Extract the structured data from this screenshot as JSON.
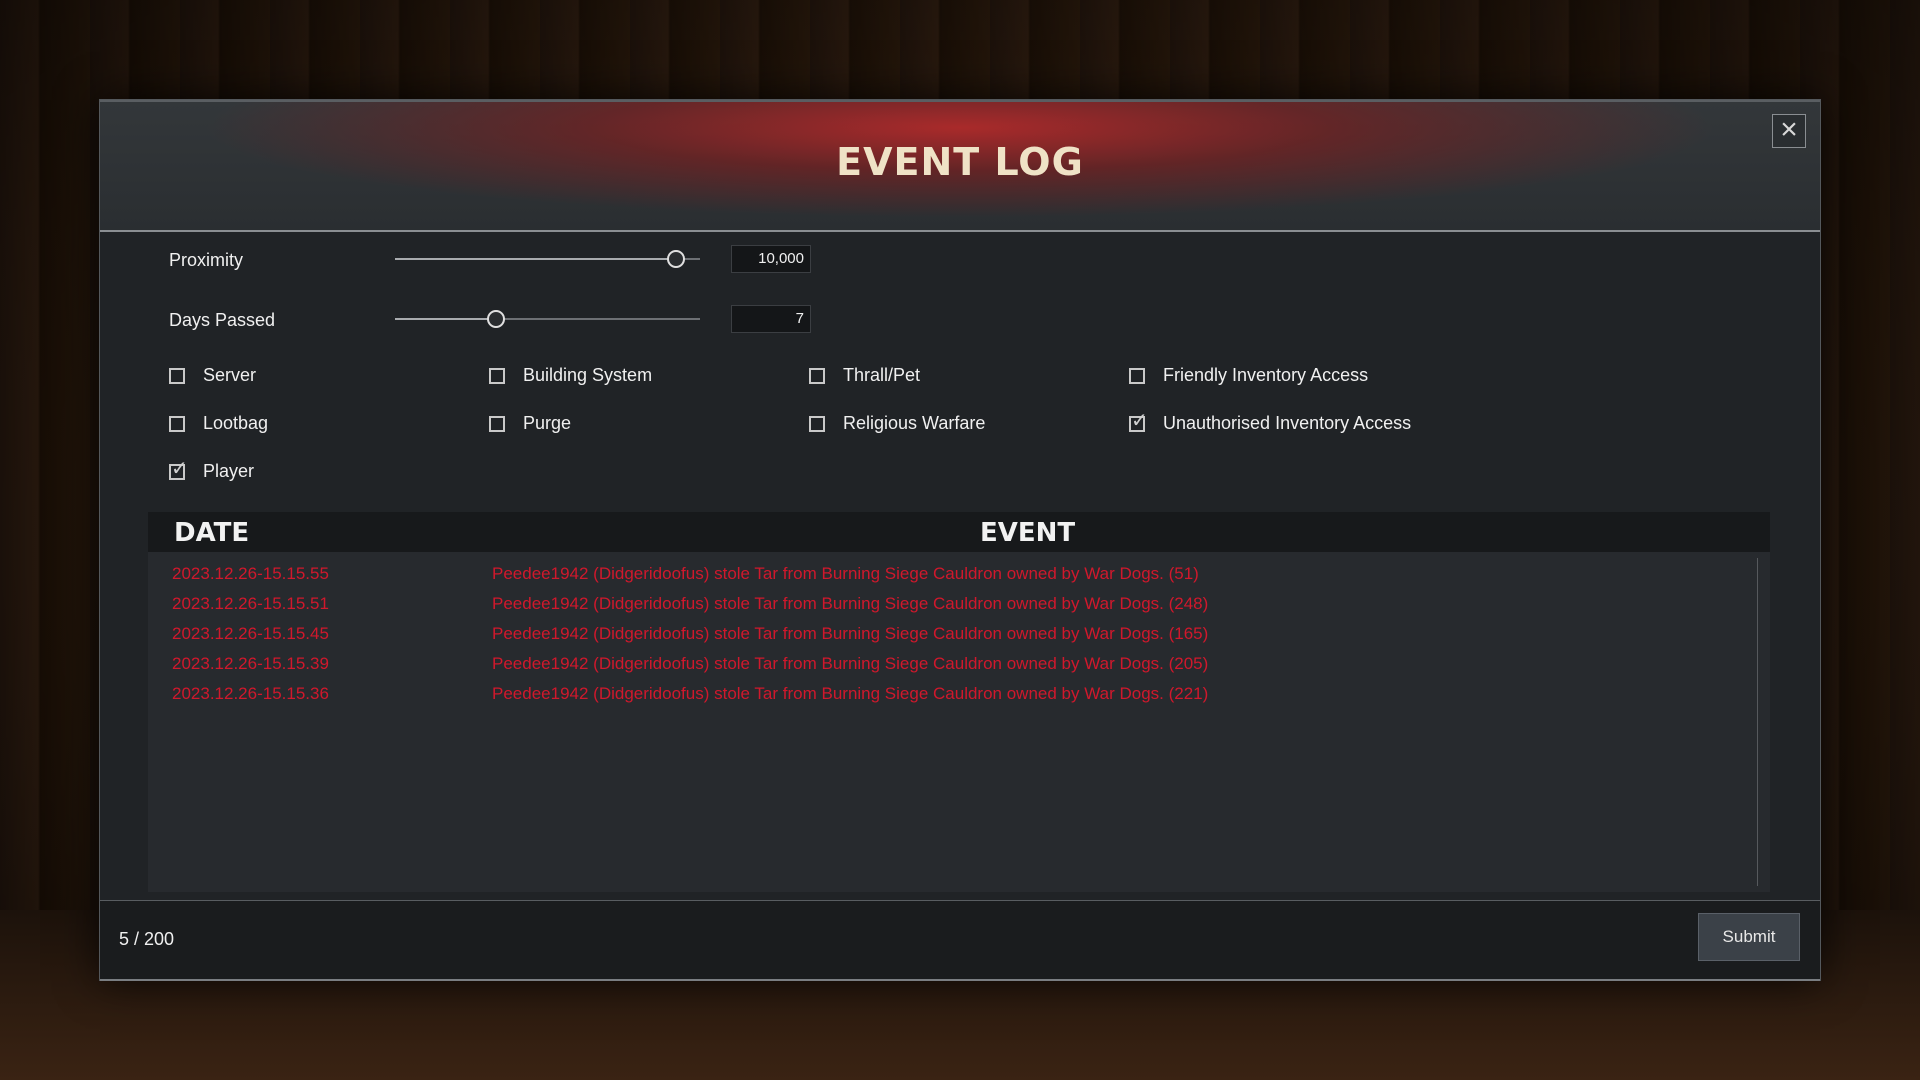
{
  "dialog": {
    "title": "EVENT LOG",
    "close_icon": "close-icon"
  },
  "filters": {
    "proximity": {
      "label": "Proximity",
      "value": "10,000",
      "slider_level": 0.92
    },
    "days_passed": {
      "label": "Days Passed",
      "value": "7",
      "slider_level": 0.33
    }
  },
  "checkboxes": [
    {
      "label": "Server",
      "checked": false
    },
    {
      "label": "Building System",
      "checked": false
    },
    {
      "label": "Thrall/Pet",
      "checked": false
    },
    {
      "label": "Friendly Inventory Access",
      "checked": false
    },
    {
      "label": "Lootbag",
      "checked": false
    },
    {
      "label": "Purge",
      "checked": false
    },
    {
      "label": "Religious Warfare",
      "checked": false
    },
    {
      "label": "Unauthorised Inventory Access",
      "checked": true
    },
    {
      "label": "Player",
      "checked": true
    }
  ],
  "log": {
    "columns": {
      "date": "DATE",
      "event": "EVENT"
    },
    "rows": [
      {
        "date": "2023.12.26-15.15.55",
        "event": "Peedee1942 (Didgeridoofus) stole Tar from Burning Siege Cauldron owned by War Dogs. (51)"
      },
      {
        "date": "2023.12.26-15.15.51",
        "event": "Peedee1942 (Didgeridoofus) stole Tar from Burning Siege Cauldron owned by War Dogs. (248)"
      },
      {
        "date": "2023.12.26-15.15.45",
        "event": "Peedee1942 (Didgeridoofus) stole Tar from Burning Siege Cauldron owned by War Dogs. (165)"
      },
      {
        "date": "2023.12.26-15.15.39",
        "event": "Peedee1942 (Didgeridoofus) stole Tar from Burning Siege Cauldron owned by War Dogs. (205)"
      },
      {
        "date": "2023.12.26-15.15.36",
        "event": "Peedee1942 (Didgeridoofus) stole Tar from Burning Siege Cauldron owned by War Dogs. (221)"
      }
    ],
    "event_text_color": "#d0182c"
  },
  "footer": {
    "count": "5 / 200",
    "submit_label": "Submit"
  }
}
